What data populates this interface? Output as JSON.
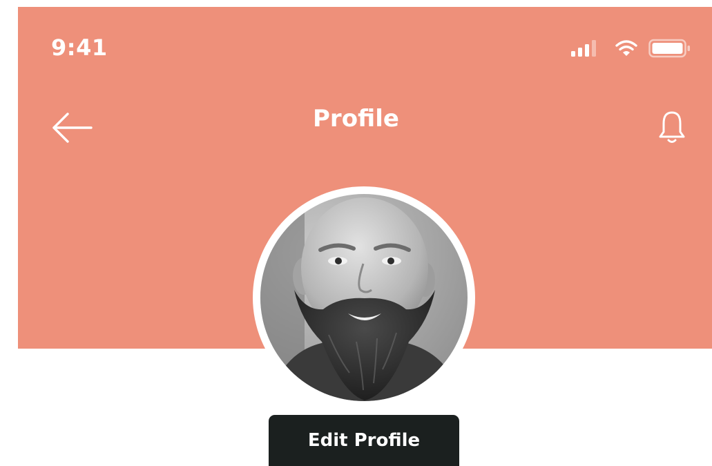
{
  "status_bar": {
    "time": "9:41",
    "icons": [
      "signal-icon",
      "wifi-icon",
      "battery-icon"
    ]
  },
  "nav": {
    "title": "Profile",
    "left_icon": "back-arrow-icon",
    "right_icon": "bell-icon"
  },
  "profile": {
    "avatar_alt": "profile-photo",
    "edit_label": "Edit Profile"
  },
  "colors": {
    "header_bg": "#ee907a",
    "button_bg": "#1b201f",
    "text_on_header": "#ffffff"
  }
}
